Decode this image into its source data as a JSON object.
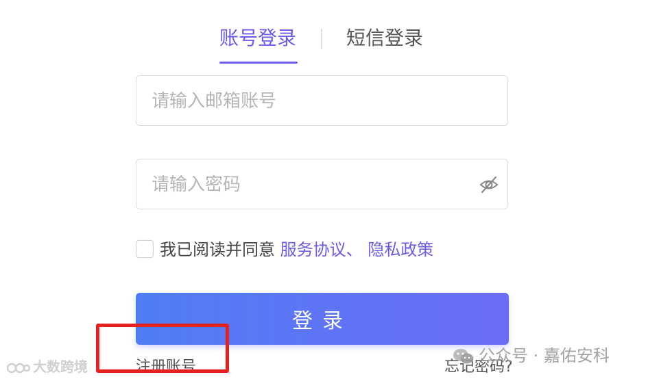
{
  "tabs": {
    "account_login": "账号登录",
    "sms_login": "短信登录"
  },
  "form": {
    "email_placeholder": "请输入邮箱账号",
    "password_placeholder": "请输入密码",
    "eye_icon": "eye-hidden-icon"
  },
  "agreement": {
    "prefix": "我已阅读并同意 ",
    "service_terms": "服务协议",
    "separator": "、 ",
    "privacy_policy": "隐私政策",
    "checked": false
  },
  "actions": {
    "login_label": "登录",
    "register_label": "注册账号",
    "forgot_label": "忘记密码?"
  },
  "watermarks": {
    "right_text": "公众号 · 嘉佑安科",
    "left_text": "大数跨境"
  },
  "colors": {
    "accent": "#6b5ce7",
    "button_start": "#4f7df3",
    "button_end": "#6c6cf6",
    "highlight": "#e5221d"
  }
}
